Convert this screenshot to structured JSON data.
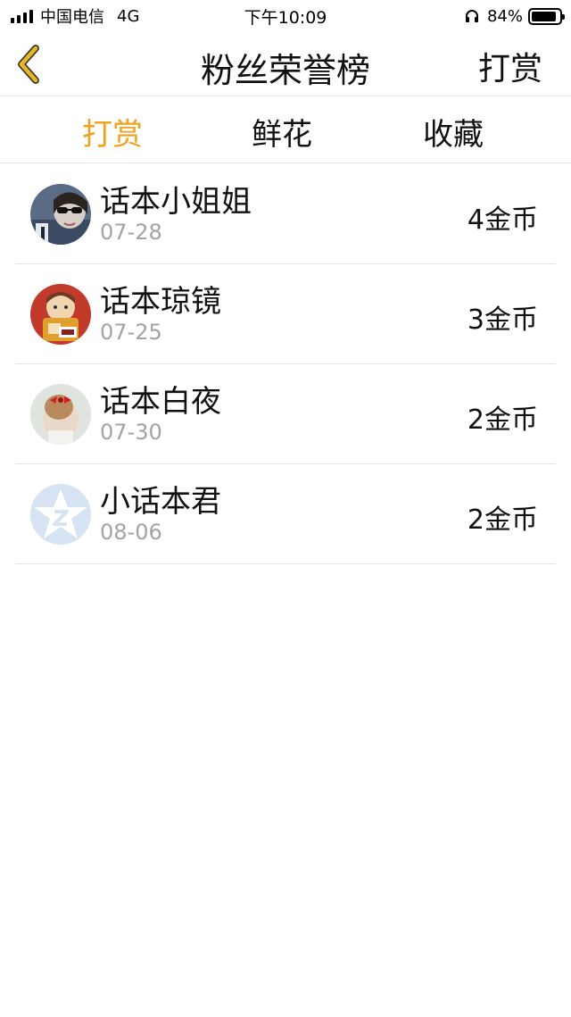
{
  "status_bar": {
    "carrier": "中国电信",
    "network": "4G",
    "time": "下午10:09",
    "battery": "84%"
  },
  "nav": {
    "title": "粉丝荣誉榜",
    "action": "打赏"
  },
  "tabs": [
    {
      "label": "打赏",
      "active": true
    },
    {
      "label": "鲜花",
      "active": false
    },
    {
      "label": "收藏",
      "active": false
    }
  ],
  "list": [
    {
      "name": "话本小姐姐",
      "date": "07-28",
      "amount": "4金币",
      "avatar": "sunglasses-avatar"
    },
    {
      "name": "话本琼镜",
      "date": "07-25",
      "amount": "3金币",
      "avatar": "cartoon-avatar"
    },
    {
      "name": "话本白夜",
      "date": "07-30",
      "amount": "2金币",
      "avatar": "red-bow-avatar"
    },
    {
      "name": "小话本君",
      "date": "08-06",
      "amount": "2金币",
      "avatar": "default-qq-avatar"
    }
  ],
  "colors": {
    "accent": "#f0a21c",
    "back_arrow": "#e8b820",
    "secondary_text": "#a3a3a3",
    "divider": "#e4e4e4"
  }
}
